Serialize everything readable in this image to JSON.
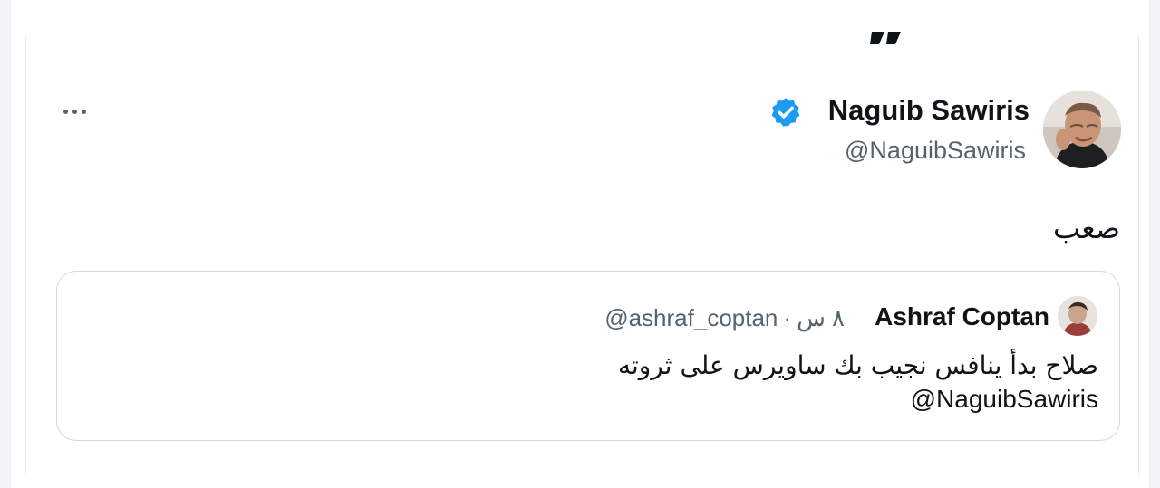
{
  "tweet": {
    "author": {
      "display_name": "Naguib Sawiris",
      "handle": "@NaguibSawiris",
      "verified": true,
      "verified_color": "#1d9bf0"
    },
    "text": "صعب",
    "more_icon": "more-horizontal-icon"
  },
  "quoted_tweet": {
    "author": {
      "display_name": "Ashraf Coptan",
      "handle": "@ashraf_coptan"
    },
    "separator": "·",
    "time": "٨ س",
    "text": "صلاح بدأ ينافس نجيب بك ساويرس على ثروته",
    "mention": "@NaguibSawiris"
  },
  "colors": {
    "text_primary": "#0f1419",
    "text_secondary": "#536471",
    "border": "#cfd9de"
  }
}
